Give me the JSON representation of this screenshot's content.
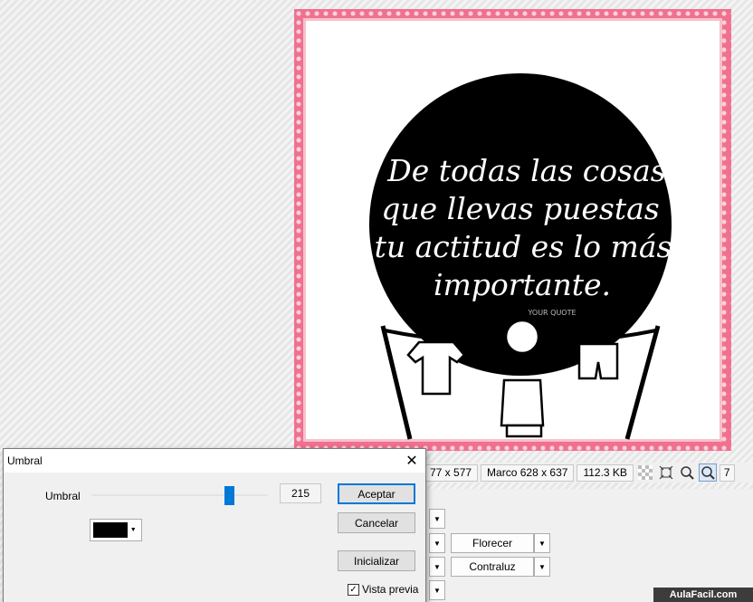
{
  "image": {
    "quote_lines": [
      "De todas las cosas",
      "que llevas puestas",
      "tu actitud es lo más",
      "importante."
    ],
    "signature": "YOUR QUOTE",
    "frame_color": "#f07090"
  },
  "status": {
    "size_label": "77 x 577",
    "frame_label": "Marco 628 x 637",
    "file_size": "112.3 KB",
    "zoom_partial": "7"
  },
  "panel": {
    "florecer_label": "Florecer",
    "contraluz_label": "Contraluz"
  },
  "dialog": {
    "title": "Umbral",
    "threshold_label": "Umbral",
    "threshold_value": "215",
    "threshold_level": 0.78,
    "accept_label": "Aceptar",
    "cancel_label": "Cancelar",
    "reset_label": "Inicializar",
    "preview_label": "Vista previa",
    "preview_checked": true,
    "color_value": "#000000"
  },
  "watermark": "AulaFacil.com",
  "colors": {
    "accent": "#0078d7"
  }
}
